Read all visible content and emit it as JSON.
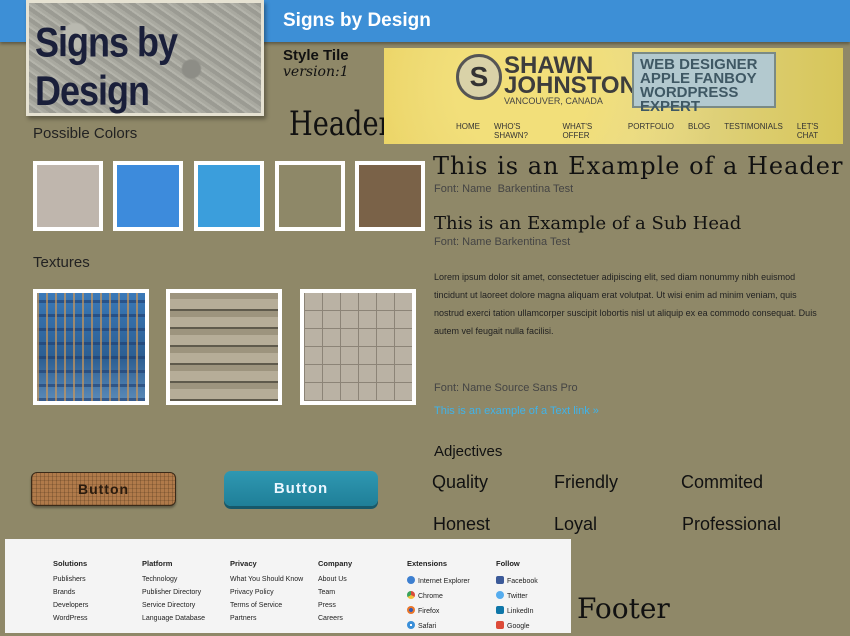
{
  "brand": {
    "title": "Signs by Design",
    "logo_text": "Signs by Design"
  },
  "tile": {
    "label": "Style Tile",
    "version": "version:1"
  },
  "header_sample": "Header",
  "colors": {
    "label": "Possible Colors",
    "swatches": [
      "#bfb6ad",
      "#3d8bdc",
      "#3b9edc",
      "#8e8868",
      "#7a6248"
    ]
  },
  "textures": {
    "label": "Textures"
  },
  "banner": {
    "badge": "S",
    "name_line1": "SHAWN",
    "name_line2": "JOHNSTON",
    "place": "VANCOUVER, CANADA",
    "roles": [
      "WEB DESIGNER",
      "APPLE FANBOY",
      "WORDPRESS EXPERT"
    ],
    "nav": [
      "HOME",
      "WHO'S SHAWN?",
      "WHAT'S OFFER",
      "PORTFOLIO",
      "BLOG",
      "TESTIMONIALS",
      "LET'S CHAT"
    ]
  },
  "typography": {
    "header": "This is an Example of a Header",
    "header_font_label": "Font: Name",
    "header_font_name": "Barkentina Test",
    "subhead": "This is an Example of a Sub Head",
    "subhead_font": "Font: Name Barkentina Test",
    "body": "Lorem ipsum dolor sit amet, consectetuer adipiscing elit, sed diam nonummy nibh euismod tincidunt ut laoreet dolore magna aliquam erat volutpat. Ut wisi enim ad minim veniam, quis nostrud exerci tation ullamcorper suscipit lobortis nisl ut aliquip ex ea commodo consequat. Duis autem vel feugait nulla facilisi.",
    "body_font": "Font: Name Source Sans Pro",
    "link": "This is an example of a Text link »"
  },
  "adjectives": {
    "title": "Adjectives",
    "items": [
      "Quality",
      "Friendly",
      "Commited",
      "Honest",
      "Loyal",
      "Professional"
    ]
  },
  "buttons": {
    "wood": "Button",
    "teal": "Button"
  },
  "footer": {
    "word": "Footer",
    "columns": [
      {
        "title": "Solutions",
        "items": [
          "Publishers",
          "Brands",
          "Developers",
          "WordPress"
        ]
      },
      {
        "title": "Platform",
        "items": [
          "Technology",
          "Publisher Directory",
          "Service Directory",
          "Language Database"
        ]
      },
      {
        "title": "Privacy",
        "items": [
          "What You Should Know",
          "Privacy Policy",
          "Terms of Service",
          "Partners"
        ]
      },
      {
        "title": "Company",
        "items": [
          "About Us",
          "Team",
          "Press",
          "Careers"
        ]
      },
      {
        "title": "Extensions",
        "items": [
          "Internet Explorer",
          "Chrome",
          "Firefox",
          "Safari"
        ]
      },
      {
        "title": "Follow",
        "items": [
          "Facebook",
          "Twitter",
          "LinkedIn",
          "Google"
        ]
      }
    ]
  }
}
